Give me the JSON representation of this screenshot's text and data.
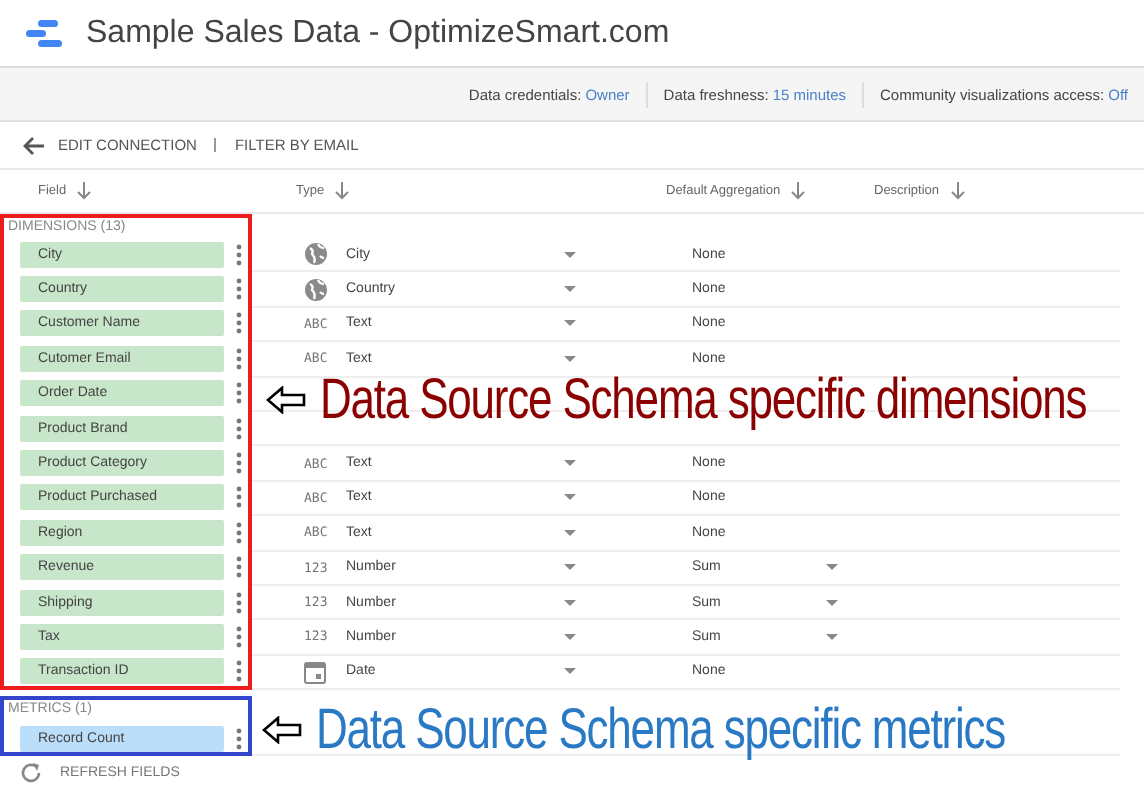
{
  "window": {
    "title": "Sample Sales Data - OptimizeSmart.com"
  },
  "info_bar": [
    {
      "label": "Data credentials:",
      "value": "Owner"
    },
    {
      "label": "Data freshness:",
      "value": "15 minutes"
    },
    {
      "label": "Community visualizations access:",
      "value": "Off"
    }
  ],
  "toolbar": {
    "back": "EDIT CONNECTION",
    "filter": "FILTER BY EMAIL"
  },
  "columns": [
    "Field",
    "Type",
    "Default Aggregation",
    "Description"
  ],
  "dimensions": {
    "label": "DIMENSIONS (13)",
    "rows": [
      {
        "field": "City",
        "type_icon": {
          "kind": "globe"
        },
        "type": "City",
        "aggregation": "None",
        "aggregation_menu": false
      },
      {
        "field": "Country",
        "type_icon": {
          "kind": "globe"
        },
        "type": "Country",
        "aggregation": "None",
        "aggregation_menu": false
      },
      {
        "field": "Customer Name",
        "type_icon": {
          "kind": "code",
          "text": "ABC"
        },
        "type": "Text",
        "aggregation": "None",
        "aggregation_menu": false
      },
      {
        "field": "Cutomer Email",
        "type_icon": {
          "kind": "code",
          "text": "ABC"
        },
        "type": "Text",
        "aggregation": "None",
        "aggregation_menu": false
      },
      {
        "field": "Order Date"
      },
      {
        "field": "Product Brand"
      },
      {
        "field": "Product Category",
        "type_icon": {
          "kind": "code",
          "text": "ABC"
        },
        "type": "Text",
        "aggregation": "None",
        "aggregation_menu": false
      },
      {
        "field": "Product Purchased",
        "type_icon": {
          "kind": "code",
          "text": "ABC"
        },
        "type": "Text",
        "aggregation": "None",
        "aggregation_menu": false
      },
      {
        "field": "Region",
        "type_icon": {
          "kind": "code",
          "text": "ABC"
        },
        "type": "Text",
        "aggregation": "None",
        "aggregation_menu": false
      },
      {
        "field": "Revenue",
        "type_icon": {
          "kind": "code",
          "text": "123"
        },
        "type": "Number",
        "aggregation": "Sum",
        "aggregation_menu": true
      },
      {
        "field": "Shipping",
        "type_icon": {
          "kind": "code",
          "text": "123"
        },
        "type": "Number",
        "aggregation": "Sum",
        "aggregation_menu": true
      },
      {
        "field": "Tax",
        "type_icon": {
          "kind": "code",
          "text": "123"
        },
        "type": "Number",
        "aggregation": "Sum",
        "aggregation_menu": true
      },
      {
        "field": "Transaction ID",
        "type_icon": {
          "kind": "calendar"
        },
        "type": "Date",
        "aggregation": "None",
        "aggregation_menu": false
      }
    ]
  },
  "metrics": {
    "label": "METRICS (1)",
    "rows": [
      {
        "field": "Record Count"
      }
    ]
  },
  "refresh": "REFRESH FIELDS",
  "annotations": [
    {
      "kind": "dimensions",
      "text": "Data Source Schema specific dimensions"
    },
    {
      "kind": "metrics",
      "text": "Data Source Schema specific metrics"
    }
  ]
}
